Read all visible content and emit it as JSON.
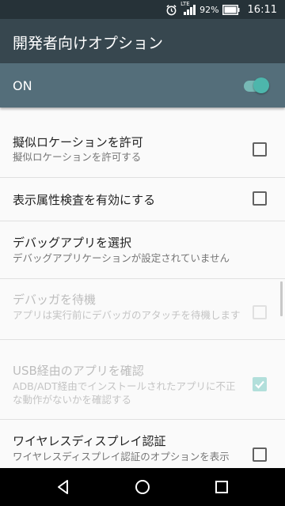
{
  "status_bar": {
    "network_label": "LTE",
    "battery_percent": "92%",
    "time": "16:11"
  },
  "app_bar": {
    "title": "開発者向けオプション"
  },
  "master_switch": {
    "label": "ON",
    "on": true
  },
  "settings": [
    {
      "title": "擬似ロケーションを許可",
      "summary": "擬似ロケーションを許可する",
      "checked": false,
      "enabled": true
    },
    {
      "title": "表示属性検査を有効にする",
      "summary": "",
      "checked": false,
      "enabled": true
    },
    {
      "title": "デバッグアプリを選択",
      "summary": "デバッグアプリケーションが設定されていません"
    },
    {
      "title": "デバッガを待機",
      "summary": "アプリは実行前にデバッガのアタッチを待機します",
      "checked": false,
      "enabled": false
    },
    {
      "title": "USB経由のアプリを確認",
      "summary": "ADB/ADT経由でインストールされたアプリに不正な動作がないかを確認する",
      "checked": true,
      "enabled": false
    },
    {
      "title": "ワイヤレスディスプレイ認証",
      "summary": "ワイヤレスディスプレイ認証のオプションを表示",
      "checked": false,
      "enabled": true
    }
  ],
  "colors": {
    "status_bar": "#263238",
    "app_bar": "#37474f",
    "master_bar": "#546e7a",
    "accent": "#4db6ac"
  },
  "icons": {
    "status": [
      "alarm-icon",
      "signal-icon",
      "battery-icon"
    ],
    "nav": [
      "back-icon",
      "home-icon",
      "recents-icon"
    ]
  }
}
